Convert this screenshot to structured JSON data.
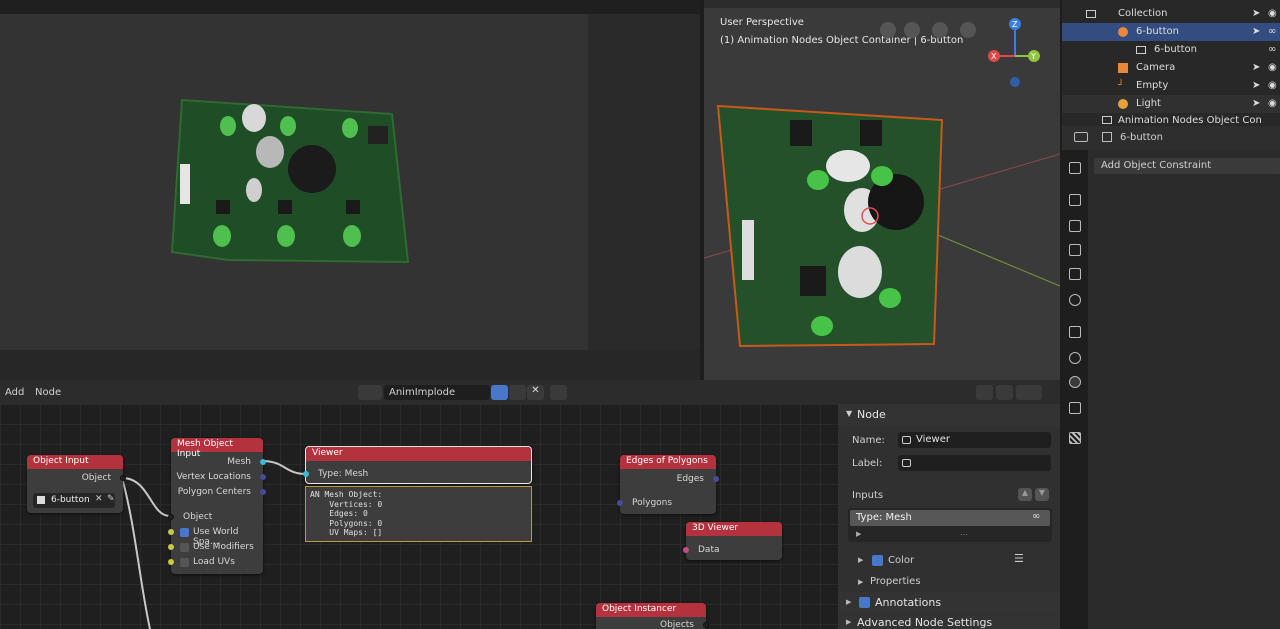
{
  "viewport": {
    "perspective": "User Perspective",
    "context": "(1) Animation Nodes Object Container | 6-button",
    "axes": {
      "x": "X",
      "y": "Y",
      "z": "Z"
    }
  },
  "outliner": {
    "items": [
      {
        "label": "Collection"
      },
      {
        "label": "6-button"
      },
      {
        "label": "6-button"
      },
      {
        "label": "Camera"
      },
      {
        "label": "Empty"
      },
      {
        "label": "Light"
      },
      {
        "label": "Animation Nodes Object Con"
      }
    ]
  },
  "properties": {
    "object_name": "6-button",
    "add_constraint": "Add Object Constraint"
  },
  "node_editor": {
    "menu": {
      "add": "Add",
      "node": "Node"
    },
    "tree_name": "AnimImplode"
  },
  "nodes": {
    "object_input": {
      "title": "Object Input",
      "output": "Object",
      "object_value": "6-button"
    },
    "mesh_object_input": {
      "title": "Mesh Object Input",
      "outputs": [
        "Mesh",
        "Vertex Locations",
        "Polygon Centers"
      ],
      "input": "Object",
      "options": [
        {
          "label": "Use World Spa...",
          "checked": true
        },
        {
          "label": "Use Modifiers",
          "checked": false
        },
        {
          "label": "Load UVs",
          "checked": false
        }
      ]
    },
    "viewer": {
      "title": "Viewer",
      "type": "Type: Mesh",
      "output_lines": [
        "AN Mesh Object:",
        "    Vertices: 0",
        "    Edges: 0",
        "    Polygons: 0",
        "    UV Maps: []"
      ]
    },
    "edges_of_polygons": {
      "title": "Edges of Polygons",
      "output": "Edges",
      "input": "Polygons"
    },
    "viewer_3d": {
      "title": "3D Viewer",
      "input": "Data"
    },
    "object_instancer": {
      "title": "Object Instancer",
      "output": "Objects"
    }
  },
  "sidepanel": {
    "section_node": "Node",
    "name_label": "Name:",
    "name_value": "Viewer",
    "label_label": "Label:",
    "label_value": "",
    "inputs_label": "Inputs",
    "input_item": "Type: Mesh",
    "color_label": "Color",
    "properties_label": "Properties",
    "annotations_label": "Annotations",
    "advanced_label": "Advanced Node Settings"
  },
  "colors": {
    "node_header": "#b3323e",
    "selection": "#334d80",
    "accent_blue": "#4a78c8"
  }
}
